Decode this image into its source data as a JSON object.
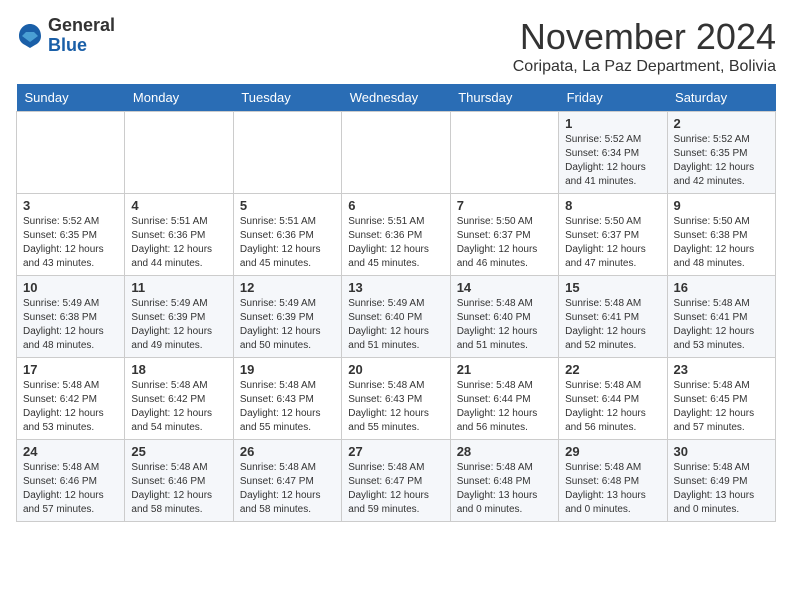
{
  "header": {
    "logo_general": "General",
    "logo_blue": "Blue",
    "month_title": "November 2024",
    "subtitle": "Coripata, La Paz Department, Bolivia"
  },
  "weekdays": [
    "Sunday",
    "Monday",
    "Tuesday",
    "Wednesday",
    "Thursday",
    "Friday",
    "Saturday"
  ],
  "weeks": [
    [
      {
        "day": "",
        "info": ""
      },
      {
        "day": "",
        "info": ""
      },
      {
        "day": "",
        "info": ""
      },
      {
        "day": "",
        "info": ""
      },
      {
        "day": "",
        "info": ""
      },
      {
        "day": "1",
        "info": "Sunrise: 5:52 AM\nSunset: 6:34 PM\nDaylight: 12 hours and 41 minutes."
      },
      {
        "day": "2",
        "info": "Sunrise: 5:52 AM\nSunset: 6:35 PM\nDaylight: 12 hours and 42 minutes."
      }
    ],
    [
      {
        "day": "3",
        "info": "Sunrise: 5:52 AM\nSunset: 6:35 PM\nDaylight: 12 hours and 43 minutes."
      },
      {
        "day": "4",
        "info": "Sunrise: 5:51 AM\nSunset: 6:36 PM\nDaylight: 12 hours and 44 minutes."
      },
      {
        "day": "5",
        "info": "Sunrise: 5:51 AM\nSunset: 6:36 PM\nDaylight: 12 hours and 45 minutes."
      },
      {
        "day": "6",
        "info": "Sunrise: 5:51 AM\nSunset: 6:36 PM\nDaylight: 12 hours and 45 minutes."
      },
      {
        "day": "7",
        "info": "Sunrise: 5:50 AM\nSunset: 6:37 PM\nDaylight: 12 hours and 46 minutes."
      },
      {
        "day": "8",
        "info": "Sunrise: 5:50 AM\nSunset: 6:37 PM\nDaylight: 12 hours and 47 minutes."
      },
      {
        "day": "9",
        "info": "Sunrise: 5:50 AM\nSunset: 6:38 PM\nDaylight: 12 hours and 48 minutes."
      }
    ],
    [
      {
        "day": "10",
        "info": "Sunrise: 5:49 AM\nSunset: 6:38 PM\nDaylight: 12 hours and 48 minutes."
      },
      {
        "day": "11",
        "info": "Sunrise: 5:49 AM\nSunset: 6:39 PM\nDaylight: 12 hours and 49 minutes."
      },
      {
        "day": "12",
        "info": "Sunrise: 5:49 AM\nSunset: 6:39 PM\nDaylight: 12 hours and 50 minutes."
      },
      {
        "day": "13",
        "info": "Sunrise: 5:49 AM\nSunset: 6:40 PM\nDaylight: 12 hours and 51 minutes."
      },
      {
        "day": "14",
        "info": "Sunrise: 5:48 AM\nSunset: 6:40 PM\nDaylight: 12 hours and 51 minutes."
      },
      {
        "day": "15",
        "info": "Sunrise: 5:48 AM\nSunset: 6:41 PM\nDaylight: 12 hours and 52 minutes."
      },
      {
        "day": "16",
        "info": "Sunrise: 5:48 AM\nSunset: 6:41 PM\nDaylight: 12 hours and 53 minutes."
      }
    ],
    [
      {
        "day": "17",
        "info": "Sunrise: 5:48 AM\nSunset: 6:42 PM\nDaylight: 12 hours and 53 minutes."
      },
      {
        "day": "18",
        "info": "Sunrise: 5:48 AM\nSunset: 6:42 PM\nDaylight: 12 hours and 54 minutes."
      },
      {
        "day": "19",
        "info": "Sunrise: 5:48 AM\nSunset: 6:43 PM\nDaylight: 12 hours and 55 minutes."
      },
      {
        "day": "20",
        "info": "Sunrise: 5:48 AM\nSunset: 6:43 PM\nDaylight: 12 hours and 55 minutes."
      },
      {
        "day": "21",
        "info": "Sunrise: 5:48 AM\nSunset: 6:44 PM\nDaylight: 12 hours and 56 minutes."
      },
      {
        "day": "22",
        "info": "Sunrise: 5:48 AM\nSunset: 6:44 PM\nDaylight: 12 hours and 56 minutes."
      },
      {
        "day": "23",
        "info": "Sunrise: 5:48 AM\nSunset: 6:45 PM\nDaylight: 12 hours and 57 minutes."
      }
    ],
    [
      {
        "day": "24",
        "info": "Sunrise: 5:48 AM\nSunset: 6:46 PM\nDaylight: 12 hours and 57 minutes."
      },
      {
        "day": "25",
        "info": "Sunrise: 5:48 AM\nSunset: 6:46 PM\nDaylight: 12 hours and 58 minutes."
      },
      {
        "day": "26",
        "info": "Sunrise: 5:48 AM\nSunset: 6:47 PM\nDaylight: 12 hours and 58 minutes."
      },
      {
        "day": "27",
        "info": "Sunrise: 5:48 AM\nSunset: 6:47 PM\nDaylight: 12 hours and 59 minutes."
      },
      {
        "day": "28",
        "info": "Sunrise: 5:48 AM\nSunset: 6:48 PM\nDaylight: 13 hours and 0 minutes."
      },
      {
        "day": "29",
        "info": "Sunrise: 5:48 AM\nSunset: 6:48 PM\nDaylight: 13 hours and 0 minutes."
      },
      {
        "day": "30",
        "info": "Sunrise: 5:48 AM\nSunset: 6:49 PM\nDaylight: 13 hours and 0 minutes."
      }
    ]
  ]
}
